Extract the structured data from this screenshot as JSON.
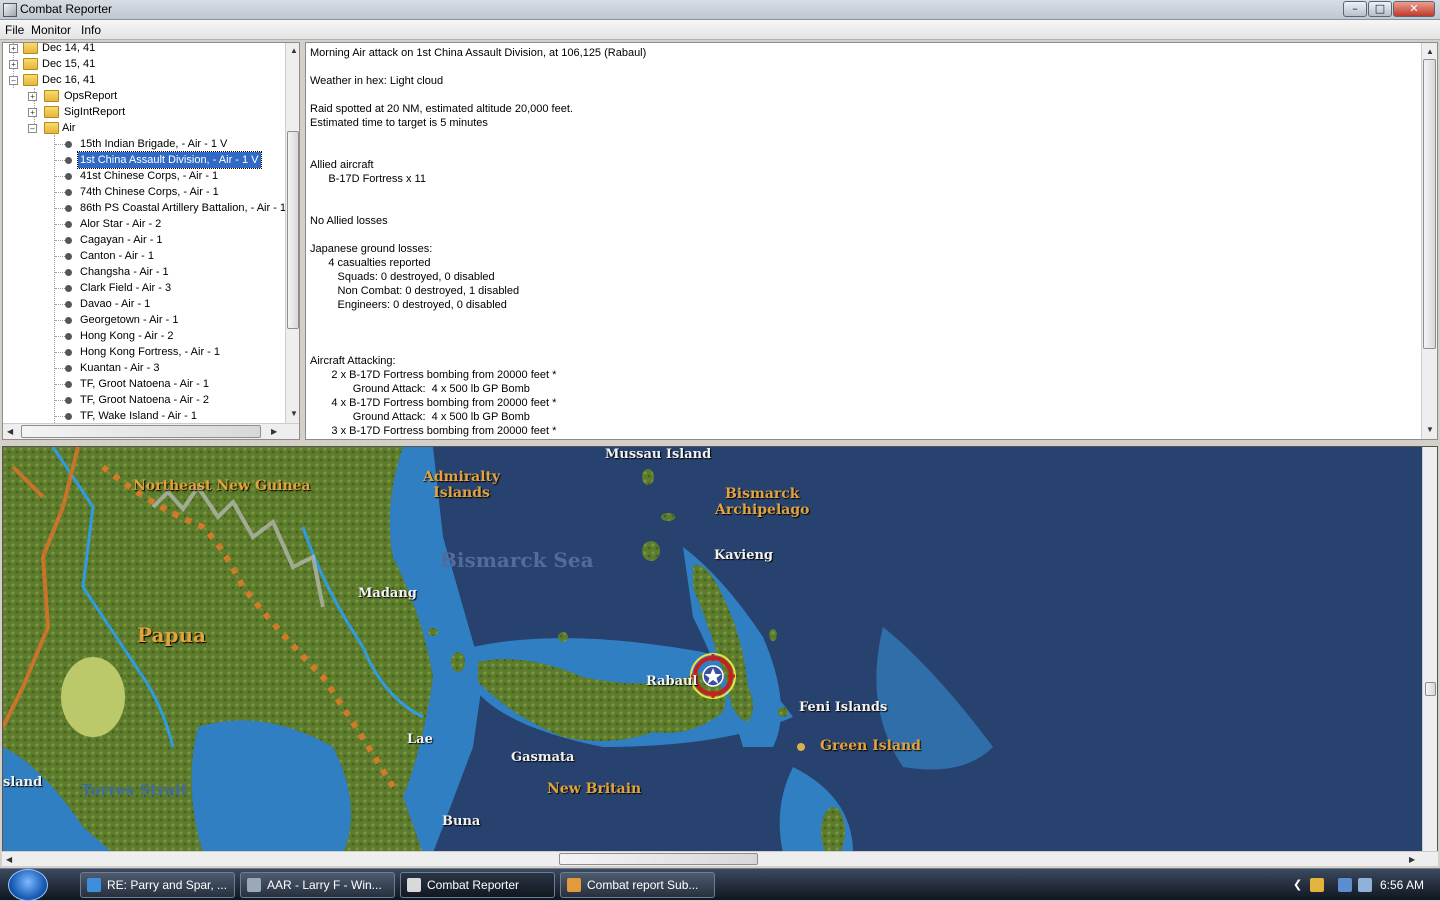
{
  "window": {
    "title": "Combat Reporter"
  },
  "menu": [
    "File",
    "Monitor",
    "Info"
  ],
  "tree": {
    "dates": [
      "Dec 14, 41",
      "Dec 15, 41",
      "Dec 16, 41"
    ],
    "folders": [
      "OpsReport",
      "SigIntReport",
      "Air"
    ],
    "air_items": [
      "15th Indian Brigade,  - Air - 1 V",
      "1st China Assault Division,  - Air - 1 V",
      "41st Chinese Corps,  - Air - 1",
      "74th Chinese Corps,  - Air - 1",
      "86th PS Coastal Artillery Battalion,  - Air - 1",
      "Alor Star  - Air - 2",
      "Cagayan  - Air - 1",
      "Canton  - Air - 1",
      "Changsha  - Air - 1",
      "Clark Field  - Air - 3",
      "Davao  - Air - 1",
      "Georgetown  - Air - 1",
      "Hong Kong  - Air - 2",
      "Hong Kong Fortress,  - Air - 1",
      "Kuantan  - Air - 3",
      "TF, Groot Natoena  - Air - 1",
      "TF, Groot Natoena  - Air - 2",
      "TF, Wake Island  - Air - 1"
    ],
    "selected_index": 1
  },
  "report": {
    "lines": [
      "Morning Air attack on 1st China Assault Division, at 106,125 (Rabaul)",
      "",
      "Weather in hex: Light cloud",
      "",
      "Raid spotted at 20 NM, estimated altitude 20,000 feet.",
      "Estimated time to target is 5 minutes",
      "",
      "",
      "Allied aircraft",
      "      B-17D Fortress x 11",
      "",
      "",
      "No Allied losses",
      "",
      "Japanese ground losses:",
      "      4 casualties reported",
      "         Squads: 0 destroyed, 0 disabled",
      "         Non Combat: 0 destroyed, 1 disabled",
      "         Engineers: 0 destroyed, 0 disabled",
      "",
      "",
      "",
      "Aircraft Attacking:",
      "       2 x B-17D Fortress bombing from 20000 feet *",
      "              Ground Attack:  4 x 500 lb GP Bomb",
      "       4 x B-17D Fortress bombing from 20000 feet *",
      "              Ground Attack:  4 x 500 lb GP Bomb",
      "       3 x B-17D Fortress bombing from 20000 feet *"
    ]
  },
  "map": {
    "labels": {
      "mussau": "Mussau Island",
      "admiralty": "Admiralty\nIslands",
      "bismarck_arch": "Bismarck\nArchipelago",
      "ne_new_guinea": "Northeast New Guinea",
      "bismarck_sea": "Bismarck Sea",
      "kavieng": "Kavieng",
      "madang": "Madang",
      "papua": "Papua",
      "rabaul": "Rabaul",
      "feni": "Feni Islands",
      "green": "Green Island",
      "lae": "Lae",
      "gasmata": "Gasmata",
      "new_britain": "New Britain",
      "island": "sland",
      "torres": "Torres Strait",
      "buna": "Buna"
    },
    "colors": {
      "sea": "#27426e",
      "shallow": "#2f7fc2",
      "land": "#5e7a2e",
      "road": "#d07a2a"
    }
  },
  "taskbar": {
    "tasks": [
      "RE: Parry and Spar, ...",
      "AAR - Larry F - Win...",
      "Combat Reporter",
      "Combat report Sub..."
    ],
    "active_index": 2,
    "clock": "6:56 AM"
  }
}
